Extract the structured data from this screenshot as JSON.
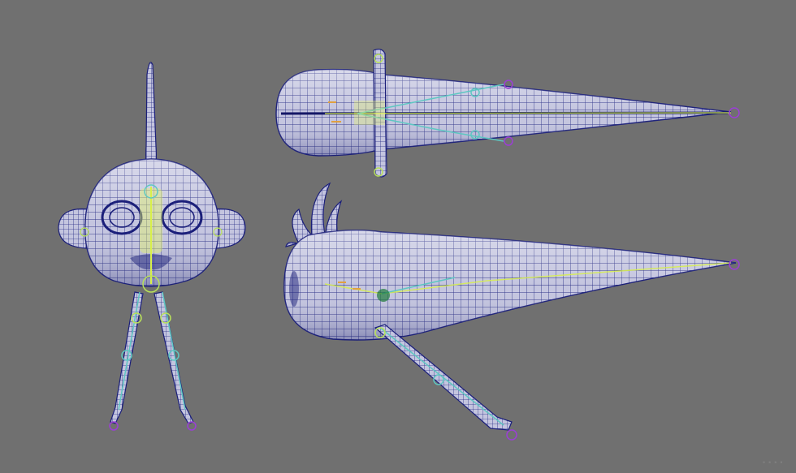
{
  "viewport": {
    "background": "#707070",
    "wire_color": "#1b1f7a",
    "wire_fill": "#bfc0dc",
    "rig_colors": {
      "spine": "#d8f04a",
      "control": "#5ec7c2",
      "joint": "#9b3fd6",
      "accent": "#e0a040"
    },
    "watermark": "...."
  },
  "views": {
    "front": "front-view",
    "top": "top-view",
    "side": "side-view"
  }
}
